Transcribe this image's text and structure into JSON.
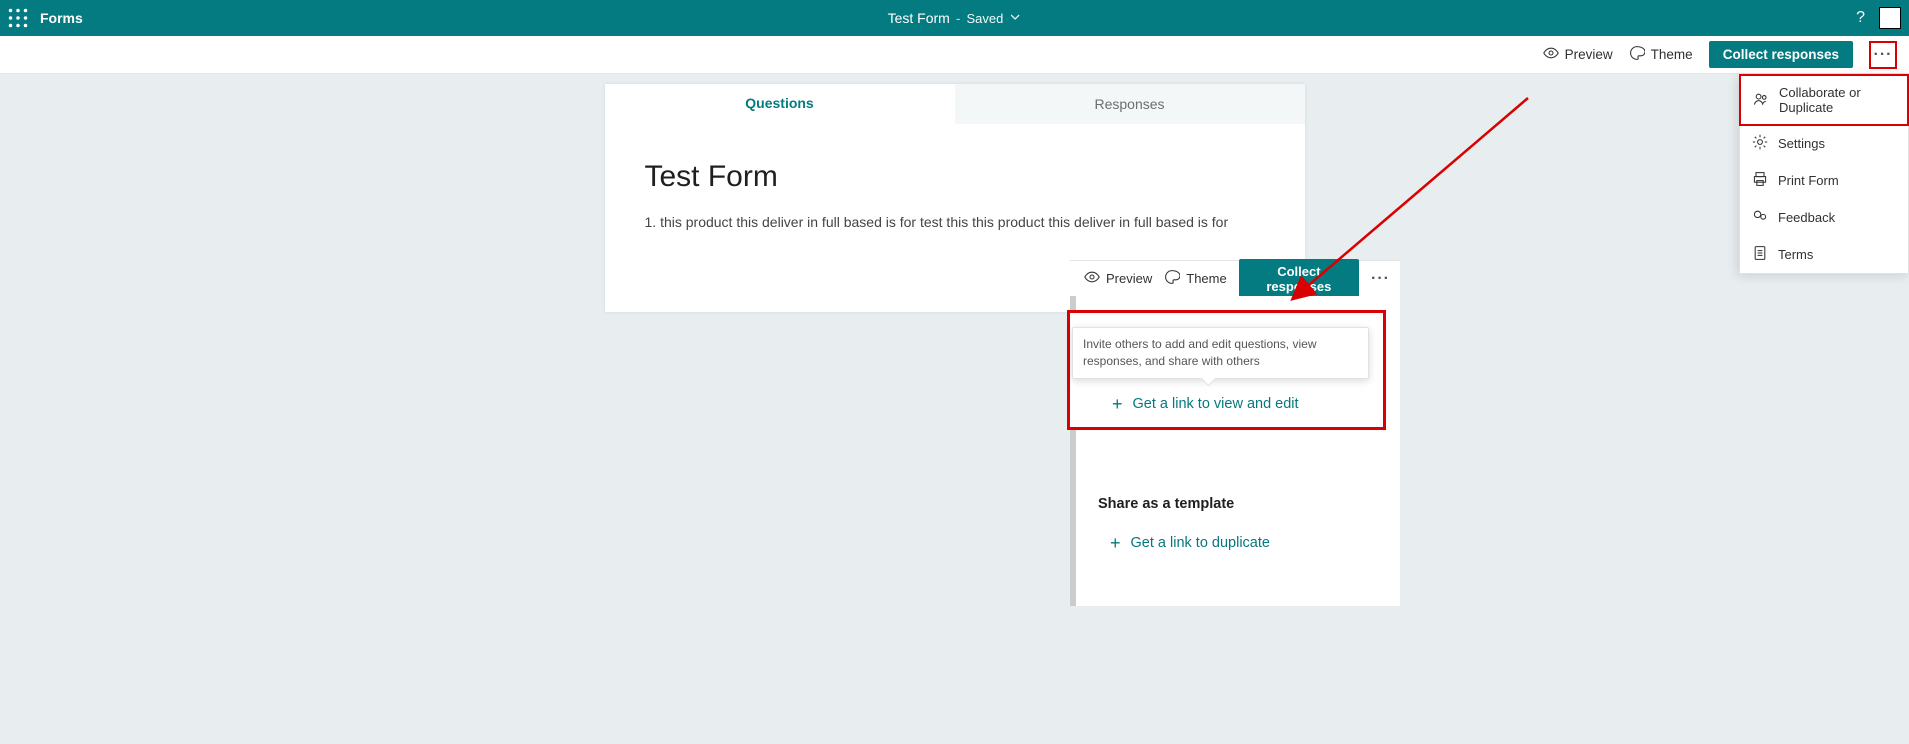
{
  "header": {
    "app_name": "Forms",
    "form_title": "Test Form",
    "saved_label": "Saved"
  },
  "toolbar": {
    "preview_label": "Preview",
    "theme_label": "Theme",
    "collect_label": "Collect responses"
  },
  "tabs": {
    "questions_label": "Questions",
    "responses_label": "Responses"
  },
  "form": {
    "title": "Test Form",
    "question1_num": "1.",
    "question1_text": "this product this deliver in full based is for test this this product this deliver in full based is for"
  },
  "dropdown": {
    "collab_label": "Collaborate or Duplicate",
    "settings_label": "Settings",
    "print_label": "Print Form",
    "feedback_label": "Feedback",
    "terms_label": "Terms"
  },
  "collab_panel": {
    "tooltip_text": "Invite others to add and edit questions, view responses, and share with others",
    "view_edit_label": "Get a link to view and edit",
    "share_template_title": "Share as a template",
    "duplicate_label": "Get a link to duplicate"
  }
}
